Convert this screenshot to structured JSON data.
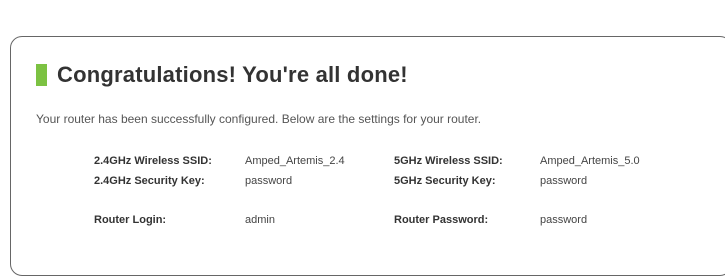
{
  "title": "Congratulations! You're all done!",
  "intro": "Your router has been successfully configured. Below are the settings for your router.",
  "colors": {
    "accent": "#7cc242",
    "border": "#666666"
  },
  "settings": {
    "ssid_24_label": "2.4GHz Wireless SSID:",
    "ssid_24_value": "Amped_Artemis_2.4",
    "ssid_5_label": "5GHz Wireless SSID:",
    "ssid_5_value": "Amped_Artemis_5.0",
    "key_24_label": "2.4GHz Security Key:",
    "key_24_value": "password",
    "key_5_label": "5GHz Security Key:",
    "key_5_value": "password",
    "login_label": "Router Login:",
    "login_value": "admin",
    "password_label": "Router Password:",
    "password_value": "password"
  }
}
